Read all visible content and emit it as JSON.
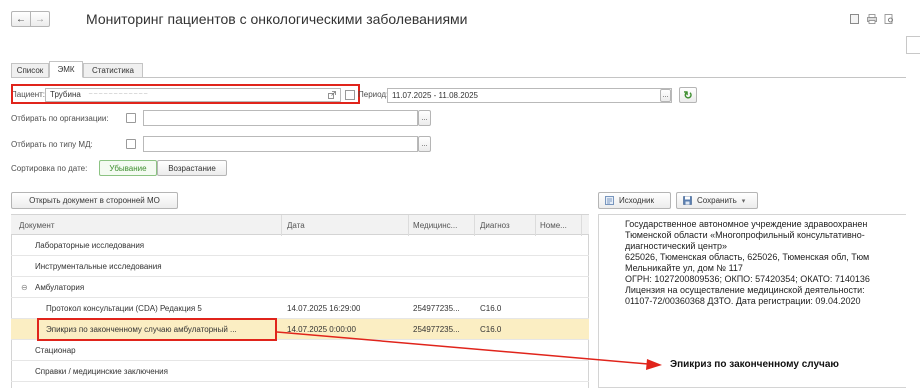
{
  "window": {
    "title": "Мониторинг пациентов с онкологическими заболеваниями",
    "nav_back": "←",
    "nav_forward": "→"
  },
  "tabs": [
    {
      "label": "Список"
    },
    {
      "label": "ЭМК",
      "active": true
    },
    {
      "label": "Статистика"
    }
  ],
  "filters": {
    "patient_label": "Пациент:",
    "patient_value": "Трубина",
    "patient_masked": "_ _ _ _ _ _ _ _ _ _ _ _",
    "period_label": "Период:",
    "period_value": "11.07.2025 - 11.08.2025",
    "org_label": "Отбирать по организации:",
    "md_type_label": "Отбирать по типу МД:",
    "sort_label": "Сортировка по дате:",
    "sort_desc": "Убывание",
    "sort_asc": "Возрастание",
    "ellipsis": "..."
  },
  "actions": {
    "open_external": "Открыть документ в сторонней МО",
    "source": "Исходник",
    "save": "Сохранить"
  },
  "table": {
    "columns": [
      "Документ",
      "Дата",
      "Медицинс...",
      "Диагноз",
      "Номе..."
    ],
    "rows": [
      {
        "doc": "Лабораторные исследования",
        "date": "",
        "med": "",
        "diag": ""
      },
      {
        "doc": "Инструментальные исследования",
        "date": "",
        "med": "",
        "diag": ""
      },
      {
        "doc": "Амбулатория",
        "date": "",
        "med": "",
        "diag": "",
        "group": true
      },
      {
        "doc": "Протокол консультации (CDA) Редакция 5",
        "date": "14.07.2025 16:29:00",
        "med": "254977235...",
        "diag": "C16.0"
      },
      {
        "doc": "Эпикриз по законченному случаю амбулаторный ...",
        "date": "14.07.2025 0:00:00",
        "med": "254977235...",
        "diag": "C16.0",
        "selected": true
      },
      {
        "doc": "Стационар",
        "date": "",
        "med": "",
        "diag": ""
      },
      {
        "doc": "Справки / медицинские заключения",
        "date": "",
        "med": "",
        "diag": ""
      }
    ]
  },
  "document_preview": {
    "lines": [
      "Государственное автономное учреждение здравоохранен",
      "Тюменской области «Многопрофильный консультативно-",
      "диагностический центр»",
      "625026, Тюменская область, 625026, Тюменская обл, Тюм",
      "Мельникайте ул, дом № 117",
      "ОГРН: 1027200809536; ОКПО: 57420354; ОКАТО: 7140136",
      "Лицензия на осуществление медицинской деятельности:",
      "01107-72/00360368 ДЗТО. Дата регистрации: 09.04.2020"
    ]
  },
  "annotation": {
    "label": "Эпикриз по законченному случаю",
    "color": "#e0241b"
  },
  "colors": {
    "accent_green": "#3e8e2f",
    "selection": "#fbeec3",
    "highlight_red": "#e0241b"
  }
}
